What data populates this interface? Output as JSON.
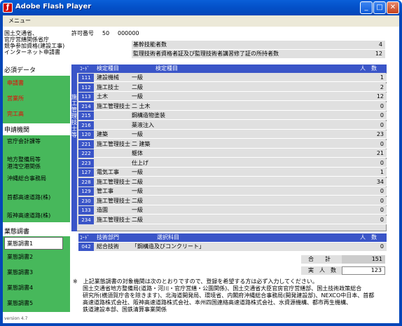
{
  "window": {
    "title": "Adobe Flash Player",
    "menu": "メニュー"
  },
  "header": {
    "org": [
      "国土交通省、",
      "官庁営繕関係省庁",
      "競争参加資格(建設工事)",
      "インターネット申請書"
    ],
    "permit_label": "許可番号",
    "permit_code": "50",
    "permit_number": "000000",
    "rows": [
      {
        "label": "基幹技能者数",
        "value": "4"
      },
      {
        "label": "監理技術者資格者証及び監理技術者講習修了証の所持者数",
        "value": "12"
      }
    ]
  },
  "sidebar": {
    "required_title": "必須データ",
    "required": [
      "申請書",
      "営業所",
      "完工高"
    ],
    "agency_title": "申請機関",
    "agencies": [
      "官庁会計課等",
      "地方整備局等\n港湾空港関係",
      "沖縄総合事務局",
      "首都高速道路(株)",
      "阪神高速道路(株)"
    ],
    "survey_title": "業態調書",
    "surveys": [
      "業態調書1",
      "業態調書2",
      "業態調書3",
      "業態調書4",
      "業態調書5"
    ],
    "version": "version 4.7"
  },
  "table": {
    "col_code": "ｺｰﾄﾞ",
    "col_type": "検定種目",
    "col_type2": "検定種目",
    "col_count": "人　数",
    "vertical": "施工管理技士",
    "kyu": "級",
    "rows": [
      {
        "code": "111",
        "name": "建設機械",
        "sub": "一級",
        "val": "1"
      },
      {
        "code": "112",
        "name": "施工技士",
        "sub": "二級",
        "val": "2"
      },
      {
        "code": "113",
        "name": "土木",
        "sub": "一級",
        "val": "12"
      },
      {
        "code": "214",
        "name": "施工管理技士",
        "sub": "二 土木",
        "val": "0"
      },
      {
        "code": "215",
        "name": "",
        "sub": "鋼構造物塗装",
        "val": "0"
      },
      {
        "code": "216",
        "name": "",
        "sub": "薬液注入",
        "val": "0"
      },
      {
        "code": "120",
        "name": "建築",
        "sub": "一級",
        "val": "23"
      },
      {
        "code": "221",
        "name": "施工管理技士",
        "sub": "二 建築",
        "val": "0"
      },
      {
        "code": "222",
        "name": "",
        "sub": "躯体",
        "val": "21"
      },
      {
        "code": "223",
        "name": "",
        "sub": "仕上げ",
        "val": "0"
      },
      {
        "code": "127",
        "name": "電気工事",
        "sub": "一級",
        "val": "1"
      },
      {
        "code": "228",
        "name": "施工管理技士",
        "sub": "二級",
        "val": "34"
      },
      {
        "code": "129",
        "name": "管工事",
        "sub": "一級",
        "val": "0"
      },
      {
        "code": "230",
        "name": "施工管理技士",
        "sub": "二級",
        "val": "0"
      },
      {
        "code": "133",
        "name": "造園",
        "sub": "一級",
        "val": "0"
      },
      {
        "code": "234",
        "name": "施工管理技士",
        "sub": "二級",
        "val": "0"
      }
    ],
    "tech_code": "ｺｰﾄﾞ",
    "tech_dept": "技術部門",
    "tech_subject": "選択科目",
    "tech_count": "人　数",
    "tech_row": {
      "code": "042",
      "name": "総合技術",
      "subject": "「鋼構造及びコンクリート」",
      "val": "0"
    },
    "total_label": "合　　計",
    "total": "151",
    "actual_label": "実　人　数",
    "actual": "123"
  },
  "note": [
    "※　上記業態調書の対象機関は次のとおりですので、登録を希望する方は必ず入力してください。",
    "国土交通省地方整備局(道路・河川・官庁営繕・公園関係)、国土交通省大臣官房官庁営繕部、国土技術政策総合",
    "研究所(横須賀庁舎を除きます)、北海道開発局、環境省、内閣府沖縄総合事務局(開発建設部)、NEXCO中日本、首都",
    "高速道路株式会社、阪神高速道路株式会社、本州四国連絡高速道路株式会社、水資源機構、都市再生機構、",
    "鉄道建設本部、国鉄清算事業関係"
  ]
}
